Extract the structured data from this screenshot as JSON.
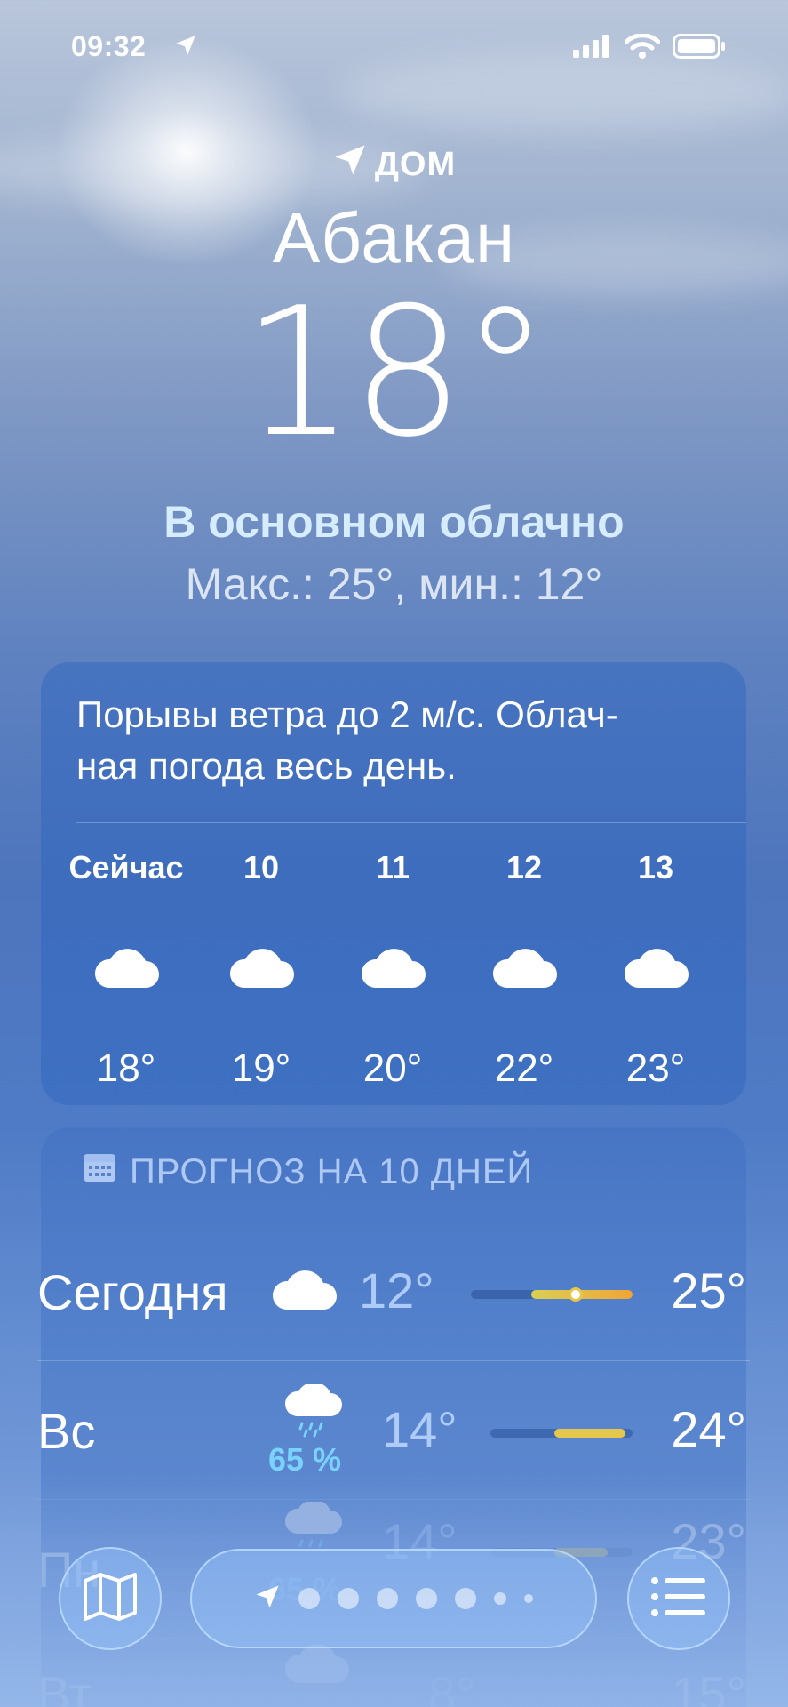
{
  "status_bar": {
    "time": "09:32"
  },
  "header": {
    "location_label": "ДОМ",
    "city": "Абакан",
    "temperature": "18°",
    "condition": "В основном облачно",
    "hi_lo": "Макс.: 25°, мин.: 12°"
  },
  "hourly": {
    "summary": "Порывы ветра до 2 м/с. Облач-\nная погода весь день.",
    "items": [
      {
        "time": "Сейчас",
        "icon": "cloud-icon",
        "temp": "18°"
      },
      {
        "time": "10",
        "icon": "cloud-icon",
        "temp": "19°"
      },
      {
        "time": "11",
        "icon": "cloud-icon",
        "temp": "20°"
      },
      {
        "time": "12",
        "icon": "cloud-icon",
        "temp": "22°"
      },
      {
        "time": "13",
        "icon": "cloud-icon",
        "temp": "23°"
      }
    ]
  },
  "daily": {
    "title": "ПРОГНОЗ НА 10 ДНЕЙ",
    "days": [
      {
        "day": "Сегодня",
        "icon": "cloud-icon",
        "precip": "",
        "min": "12°",
        "max": "25°"
      },
      {
        "day": "Вс",
        "icon": "cloud-rain-icon",
        "precip": "65 %",
        "min": "14°",
        "max": "24°"
      },
      {
        "day": "Пн",
        "icon": "cloud-rain-icon",
        "precip": "65 %",
        "min": "14°",
        "max": "23°"
      },
      {
        "day": "Вт",
        "icon": "cloud-icon",
        "precip": "",
        "min": "8°",
        "max": "15°"
      }
    ]
  },
  "colors": {
    "accent_precip": "#79d2ff",
    "range_warm": "#e7c74a",
    "range_hot": "#f0a534"
  },
  "tabbar": {
    "map_icon": "map-icon",
    "location_icon": "location-arrow-icon",
    "list_icon": "list-icon",
    "page_count": 7,
    "current_page": 1
  }
}
